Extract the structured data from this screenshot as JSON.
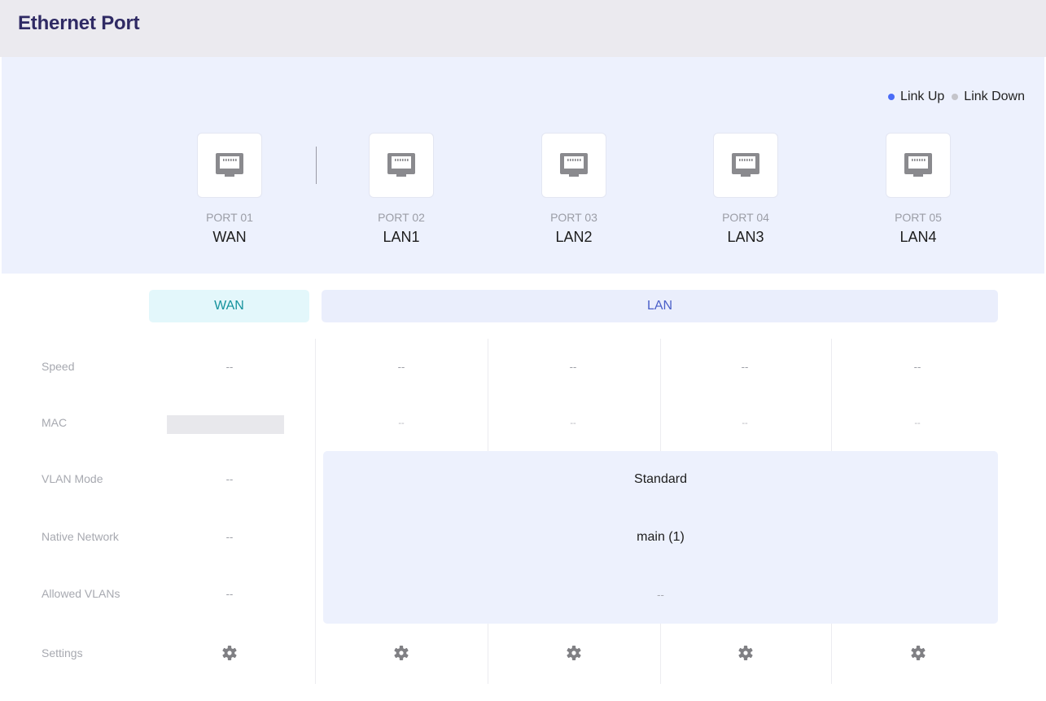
{
  "header": {
    "title": "Ethernet Port"
  },
  "legend": {
    "link_up": {
      "label": "Link Up",
      "color": "#4a6cf7"
    },
    "link_down": {
      "label": "Link Down",
      "color": "#c4c4ca"
    }
  },
  "ports": [
    {
      "number": "PORT 01",
      "name": "WAN",
      "icon": "ethernet-port-icon"
    },
    {
      "number": "PORT 02",
      "name": "LAN1",
      "icon": "ethernet-port-icon"
    },
    {
      "number": "PORT 03",
      "name": "LAN2",
      "icon": "ethernet-port-icon"
    },
    {
      "number": "PORT 04",
      "name": "LAN3",
      "icon": "ethernet-port-icon"
    },
    {
      "number": "PORT 05",
      "name": "LAN4",
      "icon": "ethernet-port-icon"
    }
  ],
  "groups": {
    "wan": "WAN",
    "lan": "LAN"
  },
  "rows": {
    "speed": "Speed",
    "mac": "MAC",
    "vlan_mode": "VLAN Mode",
    "native_network": "Native Network",
    "allowed_vlans": "Allowed VLANs",
    "settings": "Settings"
  },
  "wan": {
    "speed": "--",
    "vlan_mode": "--",
    "native_network": "--",
    "allowed_vlans": "--"
  },
  "lan_ports": [
    {
      "speed": "--",
      "mac": "--"
    },
    {
      "speed": "--",
      "mac": "--"
    },
    {
      "speed": "--",
      "mac": "--"
    },
    {
      "speed": "--",
      "mac": "--"
    }
  ],
  "lan_shared": {
    "vlan_mode": "Standard",
    "native_network": "main (1)",
    "allowed_vlans": "--"
  },
  "settings_icon": "gear-icon"
}
